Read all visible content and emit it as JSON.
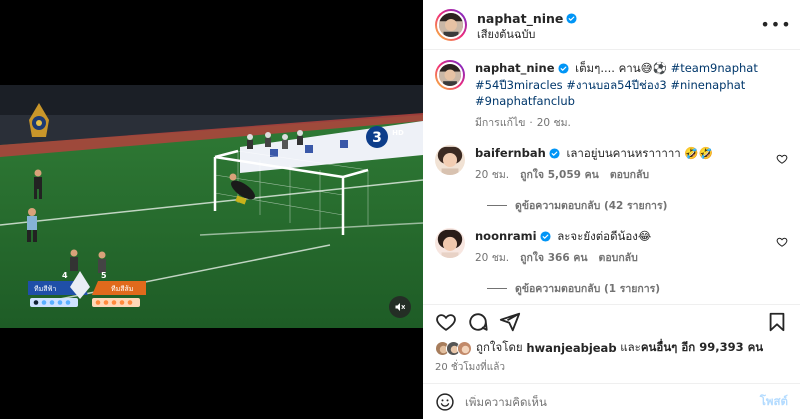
{
  "post": {
    "author": "naphat_nine",
    "audio": "เสียงต้นฉบับ"
  },
  "caption": {
    "username": "naphat_nine",
    "text": "เต็มๆ.... คาน😅⚽",
    "hashtags": "#team9naphat #54ปี3miracles #งานบอล54ปีช่อง3 #ninenaphat #9naphatfanclub",
    "edited": "มีการแก้ไข",
    "dot": "·",
    "age": "20 ชม."
  },
  "comments": [
    {
      "username": "baifernbah",
      "text": "เลาอยู่บนคานหราาาาา 🤣🤣",
      "age": "20 ชม.",
      "likes": "ถูกใจ 5,059 คน",
      "reply": "ตอบกลับ",
      "view_replies": "ดูข้อความตอบกลับ (42 รายการ)"
    },
    {
      "username": "noonrami",
      "text": "ละจะยังต่อดีน้อง😂",
      "age": "20 ชม.",
      "likes": "ถูกใจ 366 คน",
      "reply": "ตอบกลับ",
      "view_replies": "ดูข้อความตอบกลับ (1 รายการ)"
    }
  ],
  "likes_summary": {
    "prefix": "ถูกใจโดย",
    "first_user": "hwanjeabjeab",
    "middle": "และ",
    "others": "คนอื่นๆ อีก 99,393 คน"
  },
  "posted_time": "20 ชั่วโมงที่แล้ว",
  "composer": {
    "placeholder": "เพิ่มความคิดเห็น",
    "post_label": "โพสต์"
  },
  "video": {
    "scoreboard": {
      "left_team": "ทีมสีฟ้า",
      "right_team": "ทีมสีส้ม",
      "left_score": "4",
      "right_score": "5"
    },
    "channel_logo": "3",
    "channel_badge": "HD"
  },
  "icons": {
    "more": "more-options-icon",
    "verified": "verified-badge-icon",
    "heart": "heart-icon",
    "comment": "comment-icon",
    "share": "share-icon",
    "save": "bookmark-icon",
    "mute": "muted-speaker-icon",
    "emoji": "emoji-icon"
  },
  "colors": {
    "verified": "#0095f6",
    "link": "#00376b",
    "secondary_text": "#737373",
    "post_disabled": "#b3dbff"
  }
}
